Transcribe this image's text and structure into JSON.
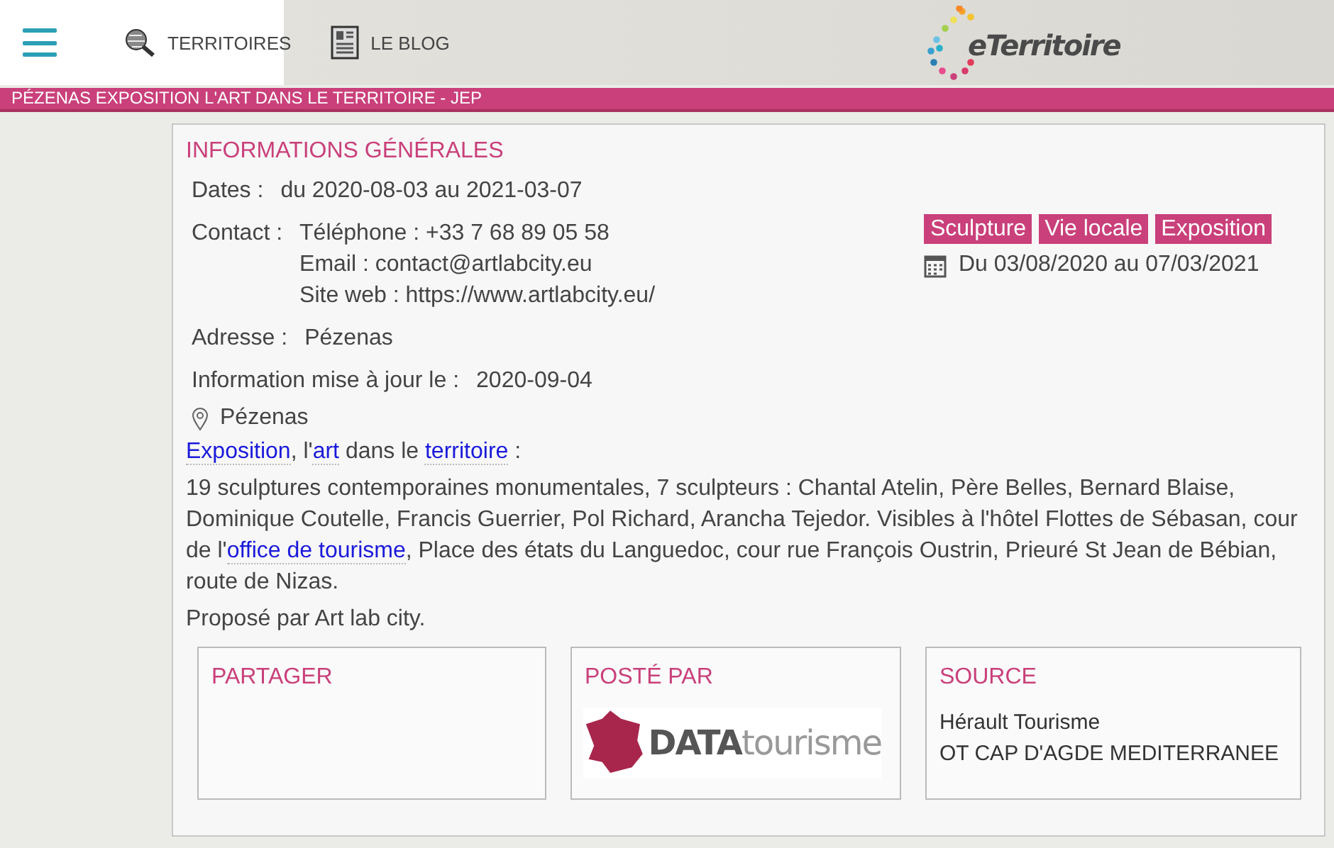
{
  "nav": {
    "items": [
      {
        "label": "TERRITOIRES",
        "kind": "globe"
      },
      {
        "label": "LE BLOG",
        "kind": "doc"
      }
    ],
    "logo": "eTerritoire"
  },
  "title_bar": "PÉZENAS EXPOSITION L'ART DANS LE TERRITOIRE - JEP",
  "info": {
    "heading": "INFORMATIONS GÉNÉRALES",
    "fields": [
      {
        "label": "Dates :",
        "values": [
          "du 2020-08-03 au 2021-03-07"
        ]
      },
      {
        "label": "Contact :",
        "values": [
          "Téléphone : +33 7 68 89 05 58",
          "Email : contact@artlabcity.eu",
          "Site web : https://www.artlabcity.eu/"
        ]
      },
      {
        "label": "Adresse :",
        "values": [
          "Pézenas"
        ]
      },
      {
        "label": "Information mise à jour le :",
        "values": [
          "2020-09-04"
        ]
      }
    ],
    "location": "Pézenas",
    "tags": [
      "Sculpture",
      "Vie locale",
      "Exposition"
    ],
    "date_range": "Du 03/08/2020 au 07/03/2021",
    "description": [
      [
        {
          "kind": "link",
          "text": "Exposition"
        },
        {
          "kind": "text",
          "text": ", l'"
        },
        {
          "kind": "link",
          "text": "art"
        },
        {
          "kind": "text",
          "text": " dans le "
        },
        {
          "kind": "link",
          "text": "territoire"
        },
        {
          "kind": "text",
          "text": " :"
        }
      ],
      [
        {
          "kind": "text",
          "text": "19 sculptures contemporaines monumentales, 7 sculpteurs : Chantal Atelin, Père Belles, Bernard Blaise, Dominique Coutelle, Francis Guerrier, Pol Richard, Arancha Tejedor. Visibles à l'hôtel Flottes de Sébasan, cour de l'"
        },
        {
          "kind": "link",
          "text": "office de tourisme"
        },
        {
          "kind": "text",
          "text": ", Place des états du Languedoc, cour rue François Oustrin, Prieuré St Jean de Bébian, route de Nizas."
        }
      ],
      [
        {
          "kind": "text",
          "text": "Proposé par Art lab city."
        }
      ]
    ]
  },
  "boxes": [
    {
      "heading": "PARTAGER",
      "kind": "empty"
    },
    {
      "heading": "POSTÉ PAR",
      "kind": "logo",
      "logo": "**DATA**tourisme"
    },
    {
      "heading": "SOURCE",
      "kind": "lines",
      "lines": [
        "Hérault Tourisme",
        "OT CAP D'AGDE MEDITERRANEE"
      ]
    }
  ]
}
